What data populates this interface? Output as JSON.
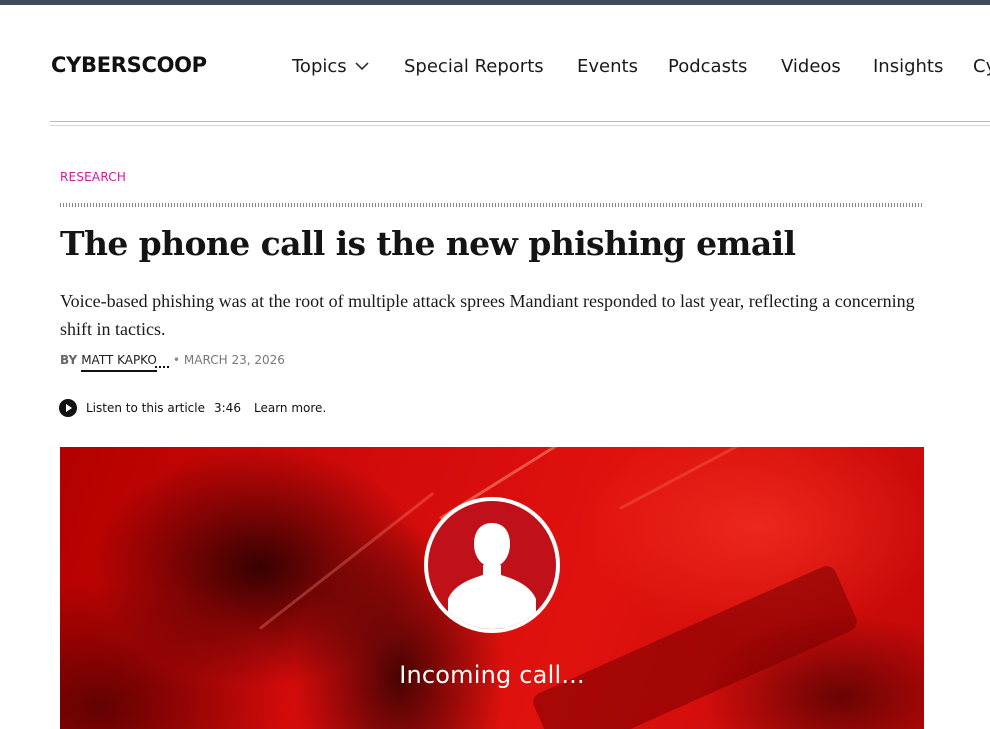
{
  "header": {
    "logo": "CYBERSCOOP",
    "nav": [
      {
        "label": "Topics",
        "has_dropdown": true
      },
      {
        "label": "Special Reports"
      },
      {
        "label": "Events"
      },
      {
        "label": "Podcasts"
      },
      {
        "label": "Videos"
      },
      {
        "label": "Insights"
      },
      {
        "label": "Cy"
      }
    ]
  },
  "article": {
    "category": "RESEARCH",
    "title": "The phone call is the new phishing email",
    "dek": "Voice-based phishing was at the root of multiple attack sprees Mandiant responded to last year, reflecting a concerning shift in tactics.",
    "byline_prefix": "BY",
    "author": "MATT KAPKO",
    "date": "MARCH 23, 2026",
    "audio": {
      "listen_label": "Listen to this article",
      "duration": "3:46",
      "learn_more": "Learn more."
    },
    "hero": {
      "caption_text": "Incoming call...",
      "icon": "user-silhouette-icon"
    }
  },
  "colors": {
    "accent_magenta": "#d6179b",
    "topbar": "#424b5a",
    "hero_red": "#d30b0b"
  }
}
